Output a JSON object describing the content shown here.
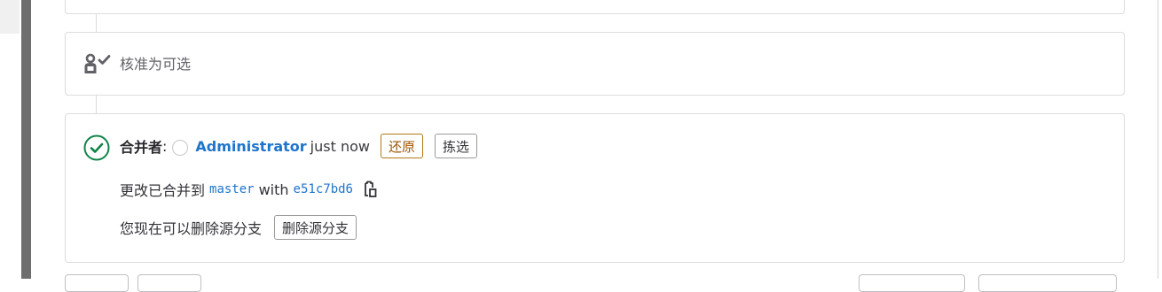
{
  "approval": {
    "text": "核准为可选",
    "icon": "approval-user-check-icon"
  },
  "merged": {
    "icon": "check-circle-icon",
    "status_color": "#108548",
    "merged_by_label": "合并者",
    "colon": ":",
    "author": "Administrator",
    "time": "just now",
    "revert_label": "还原",
    "cherry_pick_label": "拣选",
    "changes_merged_prefix": "更改已合并到",
    "target_branch": "master",
    "with_label": "with",
    "commit_sha": "e51c7bd6",
    "copy_icon": "clipboard-copy-icon",
    "delete_hint": "您现在可以删除源分支",
    "delete_source_branch_label": "删除源分支"
  },
  "colors": {
    "link": "#1f75cb",
    "revert_border": "#b07a13",
    "revert_text": "#9e5400"
  }
}
